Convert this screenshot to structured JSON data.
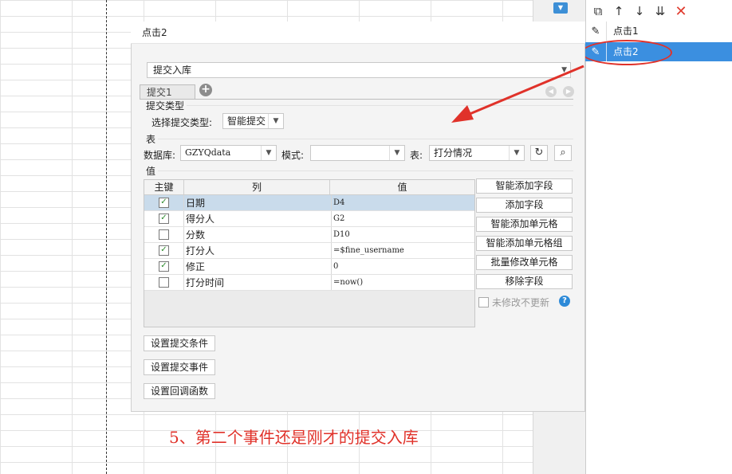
{
  "dialog": {
    "title": "点击2",
    "submit_action": "提交入库",
    "tab": "提交1",
    "submit_type_section": "提交类型",
    "submit_type_label": "选择提交类型:",
    "submit_type_value": "智能提交",
    "table_section": "表",
    "db_label": "数据库:",
    "db_value": "GZYQdata",
    "mode_label": "模式:",
    "mode_value": "",
    "table_label": "表:",
    "table_value": "打分情况",
    "value_section": "值",
    "columns": [
      "主键",
      "列",
      "值"
    ],
    "rows": [
      {
        "key": true,
        "col": "日期",
        "val": "D4",
        "selected": true
      },
      {
        "key": true,
        "col": "得分人",
        "val": "G2"
      },
      {
        "key": false,
        "col": "分数",
        "val": "D10"
      },
      {
        "key": true,
        "col": "打分人",
        "val": "=$fine_username"
      },
      {
        "key": true,
        "col": "修正",
        "val": "0"
      },
      {
        "key": false,
        "col": "打分时间",
        "val": "=now()"
      }
    ],
    "right_buttons": [
      "智能添加字段",
      "添加字段",
      "智能添加单元格",
      "智能添加单元格组",
      "批量修改单元格",
      "移除字段"
    ],
    "no_update_label": "未修改不更新",
    "bottom_buttons": [
      "设置提交条件",
      "设置提交事件",
      "设置回调函数"
    ]
  },
  "events": {
    "items": [
      {
        "label": "点击1",
        "selected": false
      },
      {
        "label": "点击2",
        "selected": true
      }
    ]
  },
  "caption": "5、第二个事件还是刚才的提交入库",
  "colors": {
    "accent": "#3b8fe0",
    "annotation": "#e0322a",
    "selected_row": "#c9dbeb"
  }
}
